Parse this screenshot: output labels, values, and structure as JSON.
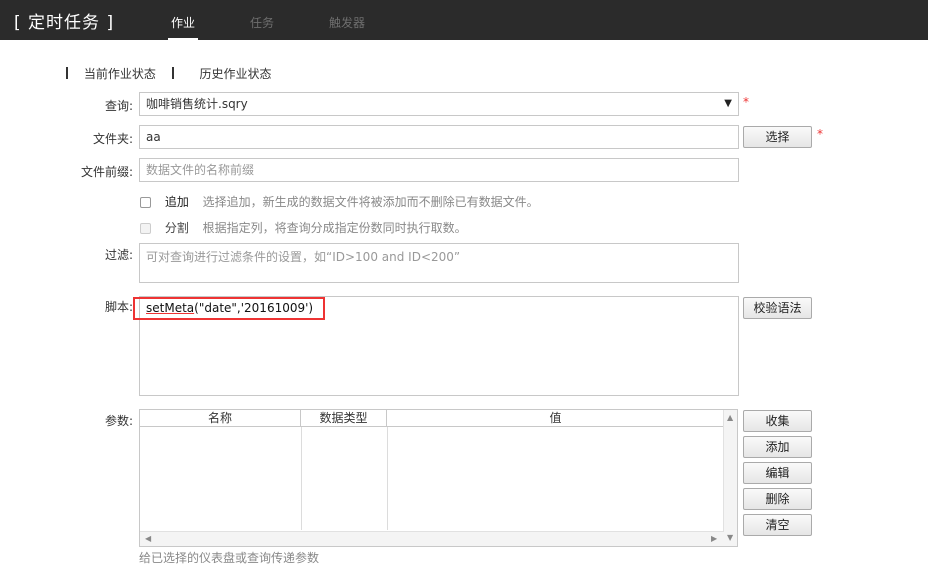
{
  "header": {
    "title": "[ 定时任务 ]",
    "tabs": [
      {
        "label": "作业",
        "active": true
      },
      {
        "label": "任务",
        "active": false
      },
      {
        "label": "触发器",
        "active": false
      }
    ]
  },
  "subtabs": [
    "当前作业状态",
    "历史作业状态"
  ],
  "form": {
    "query": {
      "label": "查询:",
      "value": "咖啡销售统计.sqry",
      "required": "*"
    },
    "folder": {
      "label": "文件夹:",
      "value": "aa",
      "button": "选择",
      "required": "*"
    },
    "prefix": {
      "label": "文件前缀:",
      "placeholder": "数据文件的名称前缀"
    },
    "append": {
      "label": "追加",
      "desc": "选择追加，新生成的数据文件将被添加而不删除已有数据文件。"
    },
    "split": {
      "label": "分割",
      "desc": "根据指定列，将查询分成指定份数同时执行取数。"
    },
    "filter": {
      "label": "过滤:",
      "placeholder": "可对查询进行过滤条件的设置，如“ID>100 and ID<200”"
    },
    "script": {
      "label": "脚本:",
      "fn": "setMeta",
      "args": "(\"date\",'20161009')",
      "button": "校验语法"
    },
    "params": {
      "label": "参数:",
      "columns": [
        "名称",
        "数据类型",
        "值"
      ],
      "buttons": [
        "收集",
        "添加",
        "编辑",
        "删除",
        "清空"
      ],
      "hint": "给已选择的仪表盘或查询传递参数"
    }
  },
  "colors": {
    "header_bg": "#2b2b2b",
    "required": "#e33333",
    "highlight": "#e33333"
  }
}
